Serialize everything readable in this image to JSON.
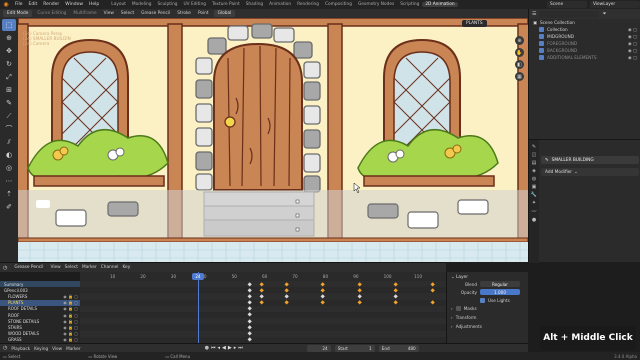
{
  "topbar": {
    "menus": [
      "File",
      "Edit",
      "Render",
      "Window",
      "Help"
    ],
    "workspaces": [
      "Layout",
      "Modeling",
      "Sculpting",
      "UV Editing",
      "Texture Paint",
      "Shading",
      "Animation",
      "Rendering",
      "Compositing",
      "Geometry Nodes",
      "Scripting",
      "2D Animation"
    ],
    "active_workspace": "2D Animation",
    "scene": "Scene",
    "view_layer": "ViewLayer"
  },
  "viewport_header": {
    "mode": "Edit Mode",
    "items": [
      "Curve Editing",
      "Multiframe",
      "View",
      "Select",
      "Grease Pencil",
      "Stroke",
      "Point"
    ],
    "orientation": "Global"
  },
  "viewport": {
    "overlay_lines": [
      "(24) Camera Persp",
      "(24) SMALLER BUILDIN",
      "(24) Camera"
    ],
    "active_layer_badge": "PLANTS",
    "colors": {
      "wall": "#fbf1c4",
      "wood": "#c98554",
      "outline": "#6b2f1a",
      "stone_light": "#e7e7e7",
      "stone_dark": "#a8a8a8",
      "leaf": "#a6d64b",
      "glass": "#cfe3e9",
      "sidewalk": "#d8e9f0"
    }
  },
  "outliner": {
    "title": "Scene Collection",
    "rows": [
      {
        "name": "Collection"
      },
      {
        "name": "MIDGROUND"
      },
      {
        "name": "FOREGROUND"
      },
      {
        "name": "BACKGROUND"
      },
      {
        "name": "ADDITIONAL ELEMENTS"
      }
    ]
  },
  "properties": {
    "object": "SMALLER BUILDING",
    "add_modifier": "Add Modifier"
  },
  "dopesheet": {
    "mode": "Grease Pencil",
    "menus": [
      "View",
      "Select",
      "Marker",
      "Channel",
      "Key"
    ],
    "ruler": [
      "10",
      "20",
      "30",
      "40",
      "50",
      "60",
      "70",
      "80",
      "90",
      "100",
      "110"
    ],
    "current_frame": "24",
    "channels": [
      "Summary",
      "GPencil.003",
      "FLOWERS",
      "PLANTS",
      "ROOF DETAILS",
      "ROOF",
      "STONE DETAILS",
      "STAIRS",
      "WOOD DETAILS",
      "GRASS"
    ],
    "key_rows": [
      {
        "keys": [
          56,
          60,
          68,
          80,
          92,
          104,
          116
        ],
        "selected": true
      },
      {
        "keys": [
          56,
          60,
          68,
          80,
          92,
          104,
          116
        ],
        "selected": true
      },
      {
        "keys": [
          56,
          60,
          68,
          80,
          92,
          104
        ],
        "selected": false
      },
      {
        "keys": [
          56,
          60,
          68,
          80,
          92,
          104,
          116
        ],
        "selected": true
      },
      {
        "keys": [
          56
        ],
        "selected": false
      },
      {
        "keys": [
          56
        ],
        "selected": false
      },
      {
        "keys": [
          56
        ],
        "selected": false
      },
      {
        "keys": [
          56
        ],
        "selected": false
      },
      {
        "keys": [
          56
        ],
        "selected": false
      },
      {
        "keys": [
          56
        ],
        "selected": false
      }
    ]
  },
  "layer_panel": {
    "title": "Layer",
    "blend_label": "Blend",
    "blend_value": "Regular",
    "opacity_label": "Opacity",
    "opacity_value": "1.000",
    "use_lights": "Use Lights",
    "sections": [
      "Masks",
      "Transform",
      "Adjustments"
    ]
  },
  "playback": {
    "items": [
      "Playback",
      "Keying",
      "View",
      "Marker"
    ],
    "frame": "24",
    "start_label": "Start",
    "start": "1",
    "end_label": "End",
    "end": "480"
  },
  "statusbar": {
    "items": [
      "Select",
      "Rotate View",
      "Call Menu"
    ],
    "version": "3.4.0 Alpha"
  },
  "key_hint": "Alt + Middle Click"
}
